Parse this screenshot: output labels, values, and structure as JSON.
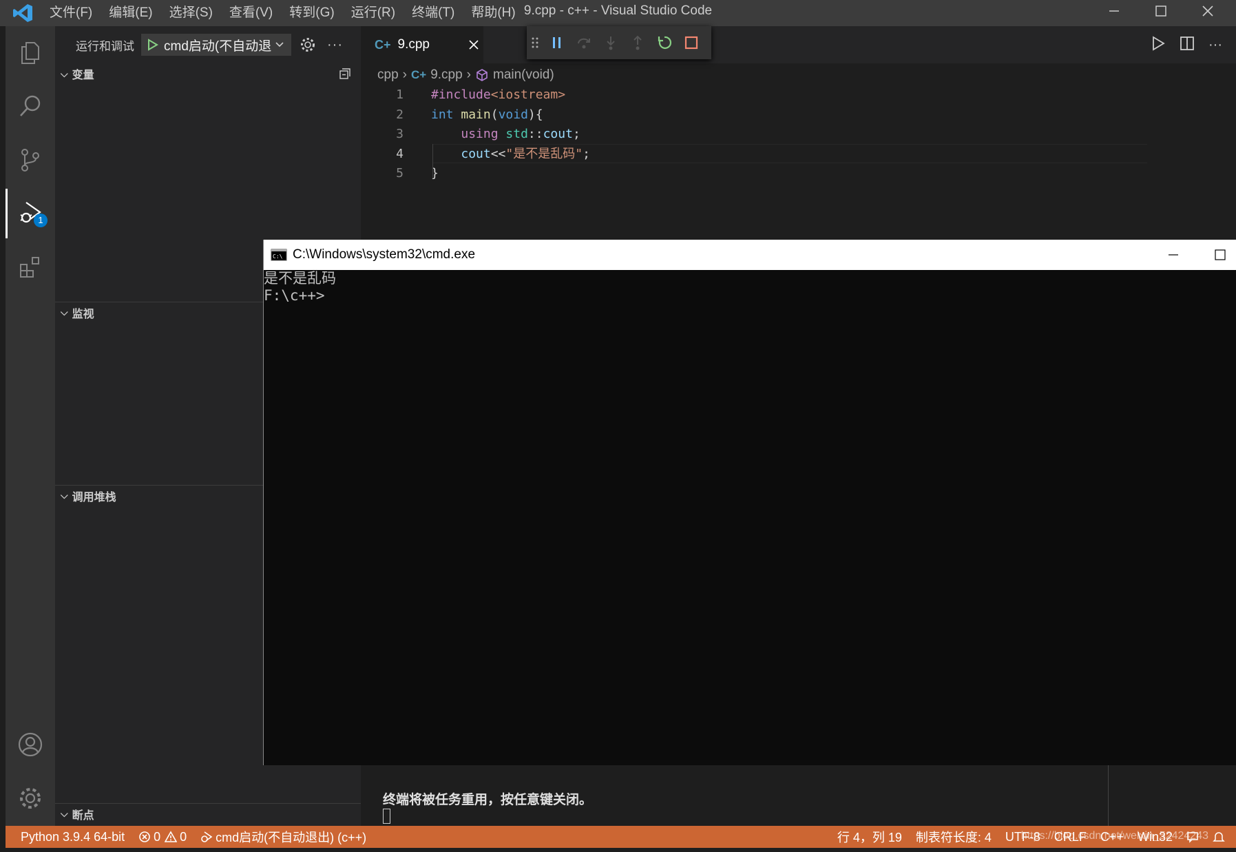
{
  "titlebar": {
    "menu": [
      "文件(F)",
      "编辑(E)",
      "选择(S)",
      "查看(V)",
      "转到(G)",
      "运行(R)",
      "终端(T)",
      "帮助(H)"
    ],
    "title": "9.cpp - c++ - Visual Studio Code"
  },
  "activity": {
    "debug_badge": "1"
  },
  "sidebar": {
    "run_label": "运行和调试",
    "config": "cmd启动(不自动退",
    "sections": {
      "variables": "变量",
      "watch": "监视",
      "callstack": "调用堆栈",
      "breakpoints": "断点"
    }
  },
  "editor": {
    "tab": "9.cpp",
    "breadcrumb": {
      "folder": "cpp",
      "file": "9.cpp",
      "symbol": "main(void)"
    },
    "lines": [
      {
        "n": "1",
        "tokens": [
          [
            "pp",
            "#include"
          ],
          [
            "str",
            "<iostream>"
          ]
        ]
      },
      {
        "n": "2",
        "tokens": [
          [
            "kw",
            "int"
          ],
          [
            "pu",
            " "
          ],
          [
            "fn",
            "main"
          ],
          [
            "pu",
            "("
          ],
          [
            "kw",
            "void"
          ],
          [
            "pu",
            "){"
          ]
        ]
      },
      {
        "n": "3",
        "tokens": [
          [
            "pu",
            "    "
          ],
          [
            "pp",
            "using"
          ],
          [
            "pu",
            " "
          ],
          [
            "ty",
            "std"
          ],
          [
            "pu",
            "::"
          ],
          [
            "id",
            "cout"
          ],
          [
            "pu",
            ";"
          ]
        ]
      },
      {
        "n": "4",
        "tokens": [
          [
            "pu",
            "    "
          ],
          [
            "id",
            "cout"
          ],
          [
            "pu",
            "<<"
          ],
          [
            "str",
            "\"是不是乱码\""
          ],
          [
            "pu",
            ";"
          ]
        ]
      },
      {
        "n": "5",
        "tokens": [
          [
            "pu",
            "}"
          ]
        ]
      }
    ],
    "current_line": "4"
  },
  "cmd": {
    "title": "C:\\Windows\\system32\\cmd.exe",
    "output": [
      "是不是乱码",
      "F:\\c++>"
    ]
  },
  "panel": {
    "message": "终端将被任务重用，按任意键关闭。"
  },
  "statusbar": {
    "python": "Python 3.9.4 64-bit",
    "errors": "0",
    "warnings": "0",
    "debug_config": "cmd启动(不自动退出) (c++)",
    "position": "行 4，列 19",
    "tab_size": "制表符长度: 4",
    "encoding": "UTF-8",
    "eol": "CRLF",
    "language": "C++",
    "platform": "Win32",
    "watermark": "https://blog.csdn.net/weixin_52424243"
  },
  "colors": {
    "statusbar": "#cc6633",
    "accent": "#007acc"
  }
}
